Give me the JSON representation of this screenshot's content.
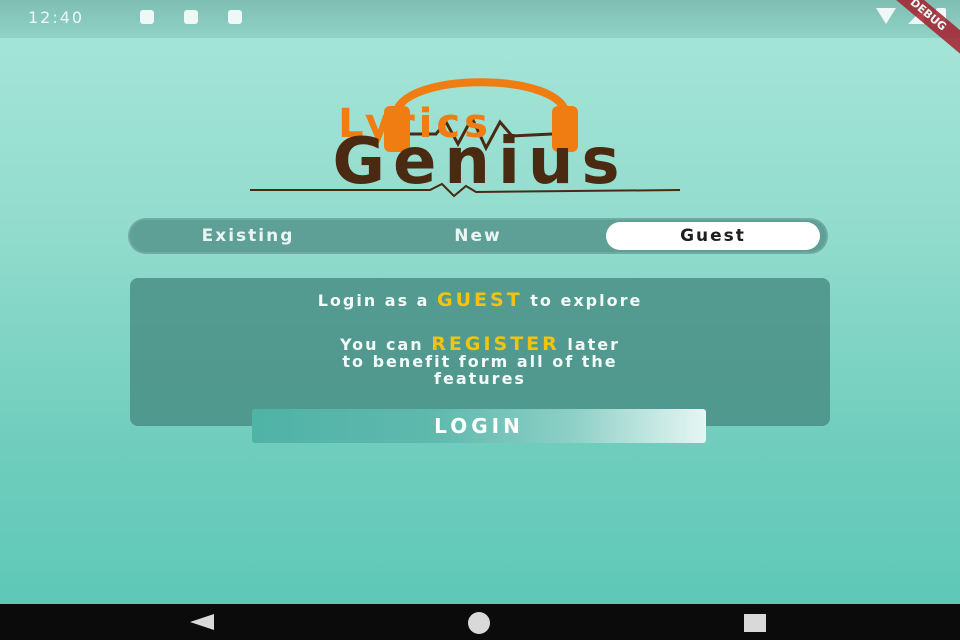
{
  "status_bar": {
    "time": "12:40",
    "debug_banner": "DEBUG"
  },
  "logo": {
    "lyrics": "Lyrics",
    "genius": "Genius",
    "icon": "headphones-icon",
    "colors": {
      "lyrics": "#f07d12",
      "genius": "#4a2b12"
    }
  },
  "tabs": {
    "items": [
      {
        "label": "Existing",
        "selected": false
      },
      {
        "label": "New",
        "selected": false
      },
      {
        "label": "Guest",
        "selected": true
      }
    ]
  },
  "card": {
    "line1_before": "Login as a ",
    "line1_accent": "GUEST",
    "line1_after": " to explore",
    "line2_before": "You can ",
    "line2_accent": "REGISTER",
    "line2_after": " later",
    "line3": "to benefit form all of the",
    "line4": "features",
    "accent_color": "#f2c40f"
  },
  "login_button": {
    "label": "LOGIN"
  },
  "nav": {
    "back": "back-icon",
    "home": "home-icon",
    "recents": "recents-icon"
  }
}
